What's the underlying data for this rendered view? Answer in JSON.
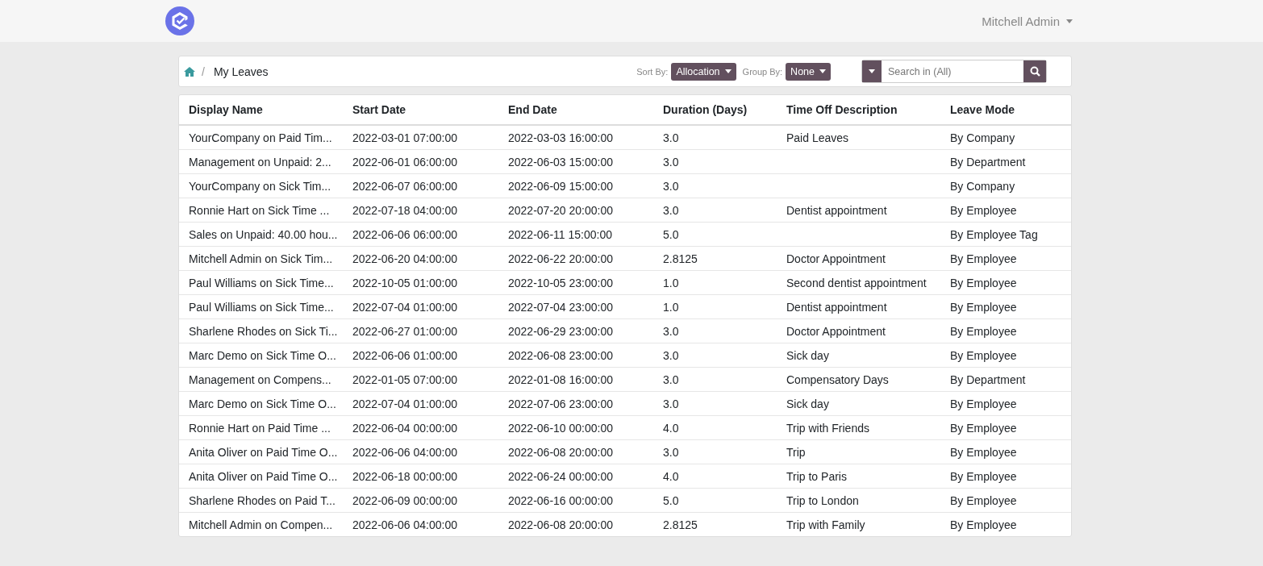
{
  "navbar": {
    "user": "Mitchell Admin"
  },
  "breadcrumb": {
    "separator": "/",
    "current": "My Leaves"
  },
  "controls": {
    "sort_label": "Sort By:",
    "sort_value": "Allocation",
    "group_label": "Group By:",
    "group_value": "None",
    "search_placeholder": "Search in (All)"
  },
  "table": {
    "columns": [
      "Display Name",
      "Start Date",
      "End Date",
      "Duration (Days)",
      "Time Off Description",
      "Leave Mode"
    ],
    "rows": [
      [
        "YourCompany on Paid Tim...",
        "2022-03-01 07:00:00",
        "2022-03-03 16:00:00",
        "3.0",
        "Paid Leaves",
        "By Company"
      ],
      [
        "Management on Unpaid: 2...",
        "2022-06-01 06:00:00",
        "2022-06-03 15:00:00",
        "3.0",
        "",
        "By Department"
      ],
      [
        "YourCompany on Sick Tim...",
        "2022-06-07 06:00:00",
        "2022-06-09 15:00:00",
        "3.0",
        "",
        "By Company"
      ],
      [
        "Ronnie Hart on Sick Time ...",
        "2022-07-18 04:00:00",
        "2022-07-20 20:00:00",
        "3.0",
        "Dentist appointment",
        "By Employee"
      ],
      [
        "Sales on Unpaid: 40.00 hou...",
        "2022-06-06 06:00:00",
        "2022-06-11 15:00:00",
        "5.0",
        "",
        "By Employee Tag"
      ],
      [
        "Mitchell Admin on Sick Tim...",
        "2022-06-20 04:00:00",
        "2022-06-22 20:00:00",
        "2.8125",
        "Doctor Appointment",
        "By Employee"
      ],
      [
        "Paul Williams on Sick Time...",
        "2022-10-05 01:00:00",
        "2022-10-05 23:00:00",
        "1.0",
        "Second dentist appointment",
        "By Employee"
      ],
      [
        "Paul Williams on Sick Time...",
        "2022-07-04 01:00:00",
        "2022-07-04 23:00:00",
        "1.0",
        "Dentist appointment",
        "By Employee"
      ],
      [
        "Sharlene Rhodes on Sick Ti...",
        "2022-06-27 01:00:00",
        "2022-06-29 23:00:00",
        "3.0",
        "Doctor Appointment",
        "By Employee"
      ],
      [
        "Marc Demo on Sick Time O...",
        "2022-06-06 01:00:00",
        "2022-06-08 23:00:00",
        "3.0",
        "Sick day",
        "By Employee"
      ],
      [
        "Management on Compens...",
        "2022-01-05 07:00:00",
        "2022-01-08 16:00:00",
        "3.0",
        "Compensatory Days",
        "By Department"
      ],
      [
        "Marc Demo on Sick Time O...",
        "2022-07-04 01:00:00",
        "2022-07-06 23:00:00",
        "3.0",
        "Sick day",
        "By Employee"
      ],
      [
        "Ronnie Hart on Paid Time ...",
        "2022-06-04 00:00:00",
        "2022-06-10 00:00:00",
        "4.0",
        "Trip with Friends",
        "By Employee"
      ],
      [
        "Anita Oliver on Paid Time O...",
        "2022-06-06 04:00:00",
        "2022-06-08 20:00:00",
        "3.0",
        "Trip",
        "By Employee"
      ],
      [
        "Anita Oliver on Paid Time O...",
        "2022-06-18 00:00:00",
        "2022-06-24 00:00:00",
        "4.0",
        "Trip to Paris",
        "By Employee"
      ],
      [
        "Sharlene Rhodes on Paid T...",
        "2022-06-09 00:00:00",
        "2022-06-16 00:00:00",
        "5.0",
        "Trip to London",
        "By Employee"
      ],
      [
        "Mitchell Admin on Compen...",
        "2022-06-06 04:00:00",
        "2022-06-08 20:00:00",
        "2.8125",
        "Trip with Family",
        "By Employee"
      ]
    ]
  }
}
